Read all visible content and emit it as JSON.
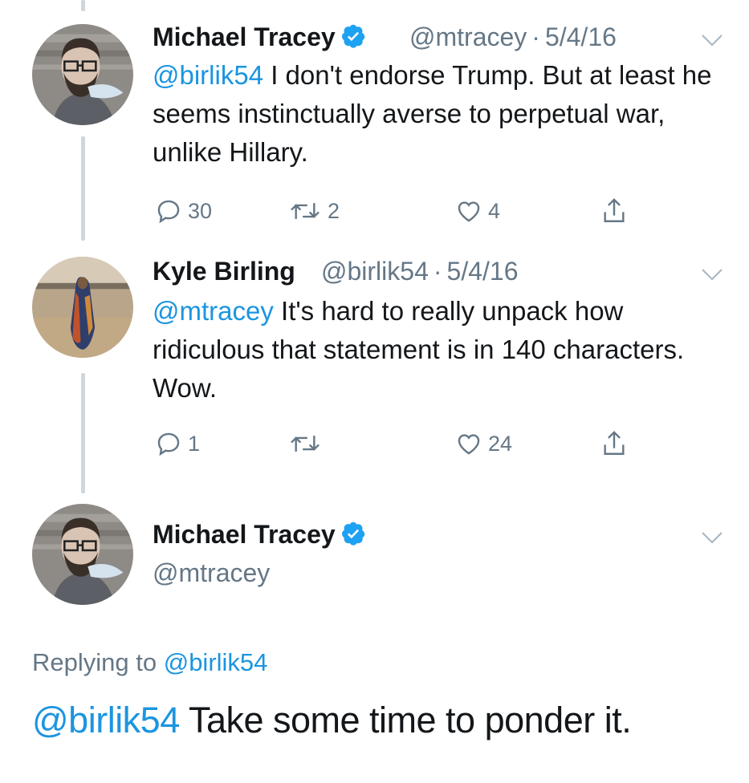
{
  "tweets": [
    {
      "name": "Michael Tracey",
      "verified": true,
      "handle": "@mtracey",
      "sep": "·",
      "date": "5/4/16",
      "mention": "@birlik54",
      "text": " I don't endorse Trump. But at least he seems instinctually averse to perpetual war, unlike Hillary.",
      "replies": "30",
      "retweets": "2",
      "likes": "4"
    },
    {
      "name": "Kyle Birling",
      "verified": false,
      "handle": "@birlik54",
      "sep": "·",
      "date": "5/4/16",
      "mention": "@mtracey",
      "text": " It's hard to really unpack how ridiculous that statement is in 140 characters. Wow.",
      "replies": "1",
      "retweets": "",
      "likes": "24"
    }
  ],
  "main_tweet": {
    "name": "Michael Tracey",
    "verified": true,
    "handle": "@mtracey",
    "replying_prefix": "Replying to ",
    "replying_to": "@birlik54",
    "mention": "@birlik54",
    "text": " Take some time to ponder it."
  },
  "icons": [
    "reply-icon",
    "retweet-icon",
    "like-icon",
    "share-icon",
    "verified-badge-icon",
    "chevron-down-icon"
  ],
  "colors": {
    "link": "#1b95e0",
    "secondary": "#657786",
    "text": "#14171a",
    "verified": "#1da1f2"
  }
}
